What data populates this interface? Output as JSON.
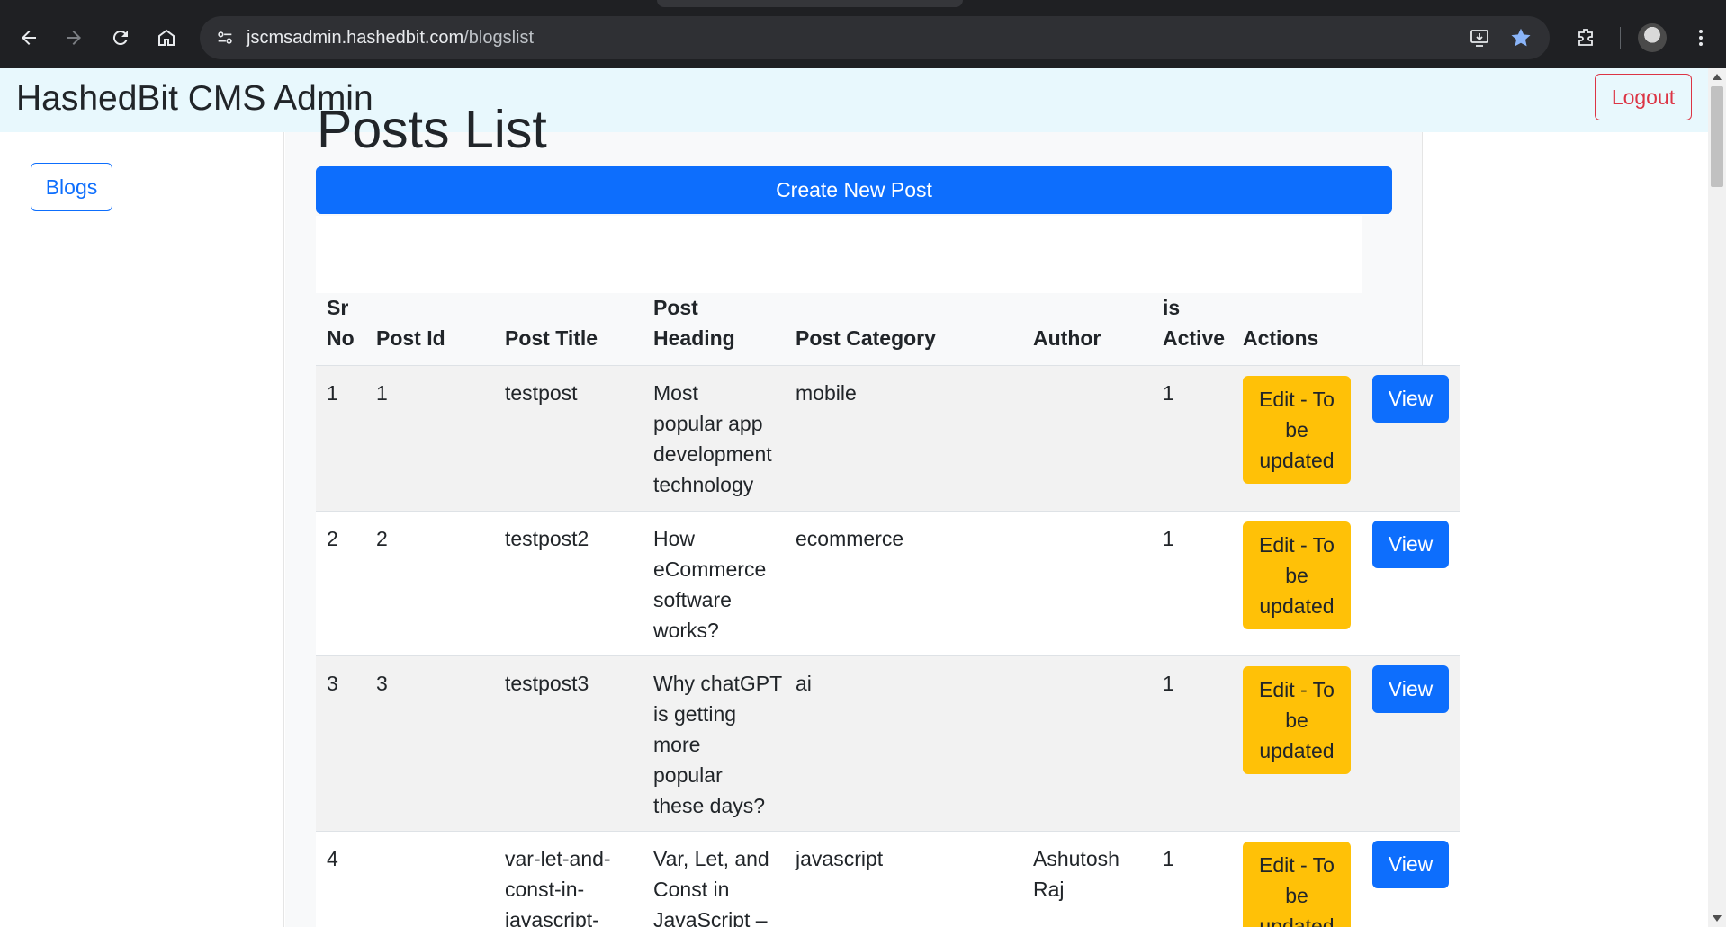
{
  "browser": {
    "url_host": "jscmsadmin.hashedbit.com",
    "url_path": "/blogslist"
  },
  "navbar": {
    "brand": "HashedBit CMS Admin",
    "logout_label": "Logout"
  },
  "sidebar": {
    "blogs_label": "Blogs"
  },
  "main": {
    "title": "Posts List",
    "create_label": "Create New Post"
  },
  "table": {
    "headers": {
      "sr_no": [
        "Sr",
        "No"
      ],
      "post_id": "Post Id",
      "post_title": "Post Title",
      "post_heading": [
        "Post",
        "Heading"
      ],
      "post_category": "Post Category",
      "author": "Author",
      "is_active": [
        "is",
        "Active"
      ],
      "actions": "Actions"
    },
    "rows": [
      {
        "sr_no": "1",
        "post_id": "1",
        "post_title": [
          "testpost"
        ],
        "post_heading": [
          "Most",
          "popular app",
          "development",
          "technology"
        ],
        "post_category": "mobile",
        "author": [],
        "is_active": "1",
        "edit_label": [
          "Edit - To",
          "be",
          "updated"
        ],
        "view_label": "View"
      },
      {
        "sr_no": "2",
        "post_id": "2",
        "post_title": [
          "testpost2"
        ],
        "post_heading": [
          "How",
          "eCommerce",
          "software",
          "works?"
        ],
        "post_category": "ecommerce",
        "author": [],
        "is_active": "1",
        "edit_label": [
          "Edit - To",
          "be",
          "updated"
        ],
        "view_label": "View"
      },
      {
        "sr_no": "3",
        "post_id": "3",
        "post_title": [
          "testpost3"
        ],
        "post_heading": [
          "Why chatGPT",
          "is getting",
          "more",
          "popular",
          "these days?"
        ],
        "post_category": "ai",
        "author": [],
        "is_active": "1",
        "edit_label": [
          "Edit - To",
          "be",
          "updated"
        ],
        "view_label": "View"
      },
      {
        "sr_no": "4",
        "post_id": "",
        "post_title": [
          "var-let-and-",
          "const-in-",
          "javascript-"
        ],
        "post_heading": [
          "Var, Let, and",
          "Const in",
          "JavaScript –"
        ],
        "post_category": "javascript",
        "author": [
          "Ashutosh",
          "Raj"
        ],
        "is_active": "1",
        "edit_label": [
          "Edit - To",
          "be",
          "updated"
        ],
        "view_label": "View"
      }
    ]
  },
  "colors": {
    "primary": "#0d6efd",
    "warning": "#ffc107",
    "danger": "#dc3545",
    "navbar_bg": "#e8f8fd",
    "chrome_bg": "#1f2023"
  }
}
